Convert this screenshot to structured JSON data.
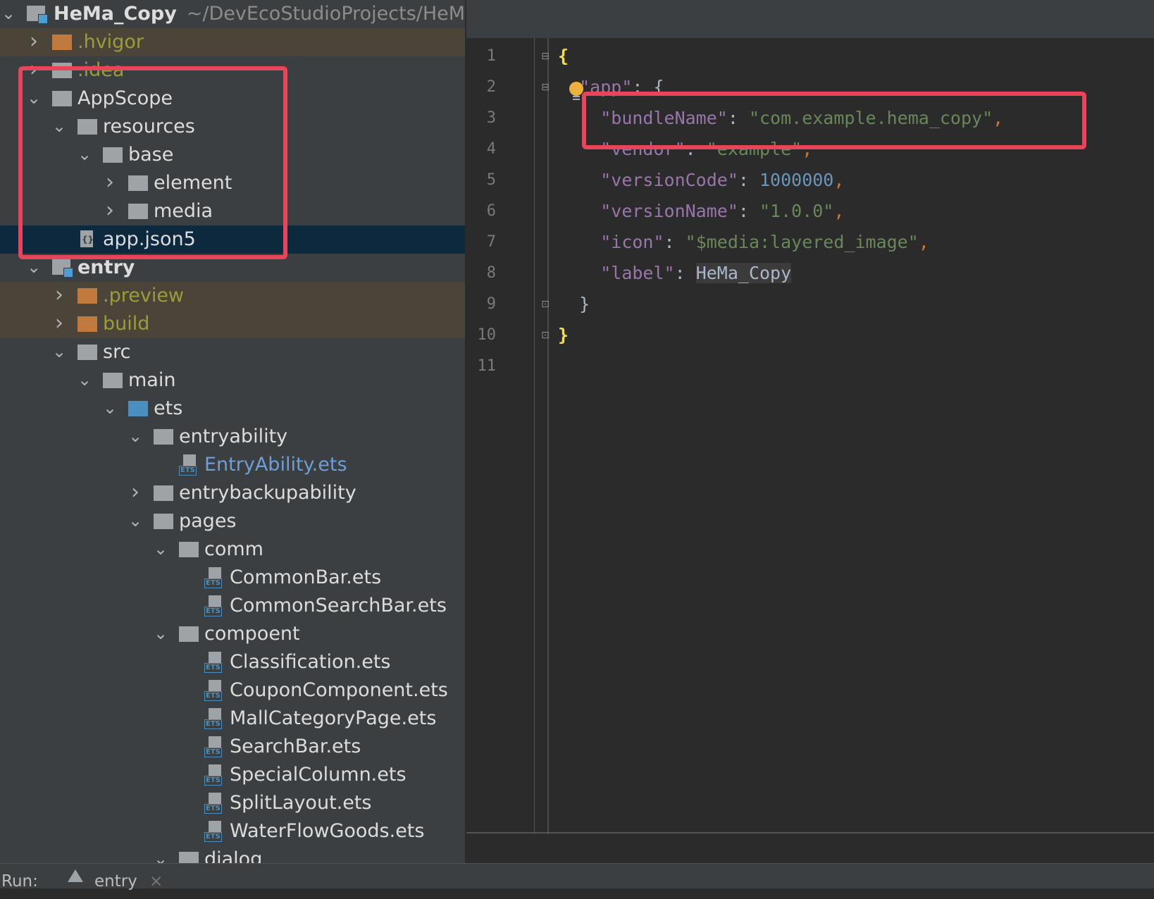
{
  "project": {
    "name": "HeMa_Copy",
    "path": "~/DevEcoStudioProjects/HeMa_C"
  },
  "tree": [
    {
      "label": ".hvigor",
      "depth": 1,
      "kind": "folder-orange",
      "expanded": false,
      "style": "muted",
      "row": "excluded"
    },
    {
      "label": ".idea",
      "depth": 1,
      "kind": "folder-grey",
      "expanded": false,
      "style": "muted",
      "row": "normal"
    },
    {
      "label": "AppScope",
      "depth": 1,
      "kind": "folder-grey",
      "expanded": true,
      "style": "normal",
      "row": "normal"
    },
    {
      "label": "resources",
      "depth": 2,
      "kind": "folder-grey",
      "expanded": true,
      "style": "normal",
      "row": "normal"
    },
    {
      "label": "base",
      "depth": 3,
      "kind": "folder-grey",
      "expanded": true,
      "style": "normal",
      "row": "normal"
    },
    {
      "label": "element",
      "depth": 4,
      "kind": "folder-grey",
      "expanded": false,
      "style": "normal",
      "row": "normal"
    },
    {
      "label": "media",
      "depth": 4,
      "kind": "folder-grey",
      "expanded": false,
      "style": "normal",
      "row": "normal"
    },
    {
      "label": "app.json5",
      "depth": 2,
      "kind": "json",
      "expanded": null,
      "style": "normal",
      "row": "selected"
    },
    {
      "label": "entry",
      "depth": 1,
      "kind": "module",
      "expanded": true,
      "style": "bold",
      "row": "normal"
    },
    {
      "label": ".preview",
      "depth": 2,
      "kind": "folder-orange",
      "expanded": false,
      "style": "muted",
      "row": "excluded"
    },
    {
      "label": "build",
      "depth": 2,
      "kind": "folder-orange",
      "expanded": false,
      "style": "muted",
      "row": "excluded"
    },
    {
      "label": "src",
      "depth": 2,
      "kind": "folder-grey",
      "expanded": true,
      "style": "normal",
      "row": "normal"
    },
    {
      "label": "main",
      "depth": 3,
      "kind": "folder-grey",
      "expanded": true,
      "style": "normal",
      "row": "normal"
    },
    {
      "label": "ets",
      "depth": 4,
      "kind": "folder-blue",
      "expanded": true,
      "style": "normal",
      "row": "normal"
    },
    {
      "label": "entryability",
      "depth": 5,
      "kind": "folder-grey",
      "expanded": true,
      "style": "normal",
      "row": "normal"
    },
    {
      "label": "EntryAbility.ets",
      "depth": 6,
      "kind": "ets",
      "expanded": null,
      "style": "blue",
      "row": "normal"
    },
    {
      "label": "entrybackupability",
      "depth": 5,
      "kind": "folder-grey",
      "expanded": false,
      "style": "normal",
      "row": "normal"
    },
    {
      "label": "pages",
      "depth": 5,
      "kind": "folder-grey",
      "expanded": true,
      "style": "normal",
      "row": "normal"
    },
    {
      "label": "comm",
      "depth": 6,
      "kind": "folder-grey",
      "expanded": true,
      "style": "normal",
      "row": "normal"
    },
    {
      "label": "CommonBar.ets",
      "depth": 7,
      "kind": "ets",
      "expanded": null,
      "style": "normal",
      "row": "normal"
    },
    {
      "label": "CommonSearchBar.ets",
      "depth": 7,
      "kind": "ets",
      "expanded": null,
      "style": "normal",
      "row": "normal"
    },
    {
      "label": "compoent",
      "depth": 6,
      "kind": "folder-grey",
      "expanded": true,
      "style": "normal",
      "row": "normal"
    },
    {
      "label": "Classification.ets",
      "depth": 7,
      "kind": "ets",
      "expanded": null,
      "style": "normal",
      "row": "normal"
    },
    {
      "label": "CouponComponent.ets",
      "depth": 7,
      "kind": "ets",
      "expanded": null,
      "style": "normal",
      "row": "normal"
    },
    {
      "label": "MallCategoryPage.ets",
      "depth": 7,
      "kind": "ets",
      "expanded": null,
      "style": "normal",
      "row": "normal"
    },
    {
      "label": "SearchBar.ets",
      "depth": 7,
      "kind": "ets",
      "expanded": null,
      "style": "normal",
      "row": "normal"
    },
    {
      "label": "SpecialColumn.ets",
      "depth": 7,
      "kind": "ets",
      "expanded": null,
      "style": "normal",
      "row": "normal"
    },
    {
      "label": "SplitLayout.ets",
      "depth": 7,
      "kind": "ets",
      "expanded": null,
      "style": "normal",
      "row": "normal"
    },
    {
      "label": "WaterFlowGoods.ets",
      "depth": 7,
      "kind": "ets",
      "expanded": null,
      "style": "normal",
      "row": "normal"
    },
    {
      "label": "dialog",
      "depth": 6,
      "kind": "folder-grey",
      "expanded": true,
      "style": "normal",
      "row": "normal"
    }
  ],
  "editor": {
    "line_numbers": [
      "1",
      "2",
      "3",
      "4",
      "5",
      "6",
      "7",
      "8",
      "9",
      "10",
      "11"
    ],
    "lines": [
      {
        "tokens": [
          {
            "t": "{",
            "c": "brace"
          }
        ]
      },
      {
        "tokens": [
          {
            "t": "  ",
            "c": ""
          },
          {
            "t": "\"app\"",
            "c": "k"
          },
          {
            "t": ": {",
            "c": ""
          }
        ]
      },
      {
        "tokens": [
          {
            "t": "    ",
            "c": ""
          },
          {
            "t": "\"bundleName\"",
            "c": "k"
          },
          {
            "t": ": ",
            "c": ""
          },
          {
            "t": "\"com.example.hema_copy\"",
            "c": "s"
          },
          {
            "t": ",",
            "c": "p"
          }
        ]
      },
      {
        "tokens": [
          {
            "t": "    ",
            "c": ""
          },
          {
            "t": "\"vendor\"",
            "c": "k"
          },
          {
            "t": ": ",
            "c": ""
          },
          {
            "t": "\"example\"",
            "c": "s"
          },
          {
            "t": ",",
            "c": "p"
          }
        ]
      },
      {
        "tokens": [
          {
            "t": "    ",
            "c": ""
          },
          {
            "t": "\"versionCode\"",
            "c": "k"
          },
          {
            "t": ": ",
            "c": ""
          },
          {
            "t": "1000000",
            "c": "n"
          },
          {
            "t": ",",
            "c": "p"
          }
        ]
      },
      {
        "tokens": [
          {
            "t": "    ",
            "c": ""
          },
          {
            "t": "\"versionName\"",
            "c": "k"
          },
          {
            "t": ": ",
            "c": ""
          },
          {
            "t": "\"1.0.0\"",
            "c": "s"
          },
          {
            "t": ",",
            "c": "p"
          }
        ]
      },
      {
        "tokens": [
          {
            "t": "    ",
            "c": ""
          },
          {
            "t": "\"icon\"",
            "c": "k"
          },
          {
            "t": ": ",
            "c": ""
          },
          {
            "t": "\"$media:layered_image\"",
            "c": "s"
          },
          {
            "t": ",",
            "c": "p"
          }
        ]
      },
      {
        "tokens": [
          {
            "t": "    ",
            "c": ""
          },
          {
            "t": "\"label\"",
            "c": "k"
          },
          {
            "t": ": ",
            "c": ""
          },
          {
            "t": "HeMa_Copy",
            "c": "hl"
          }
        ]
      },
      {
        "tokens": [
          {
            "t": "  }",
            "c": ""
          }
        ]
      },
      {
        "tokens": [
          {
            "t": "}",
            "c": "brace"
          }
        ]
      },
      {
        "tokens": []
      }
    ]
  },
  "runbar": {
    "label": "Run:",
    "tab": "entry",
    "close": "×"
  },
  "colors": {
    "annotation": "#e8445a"
  }
}
